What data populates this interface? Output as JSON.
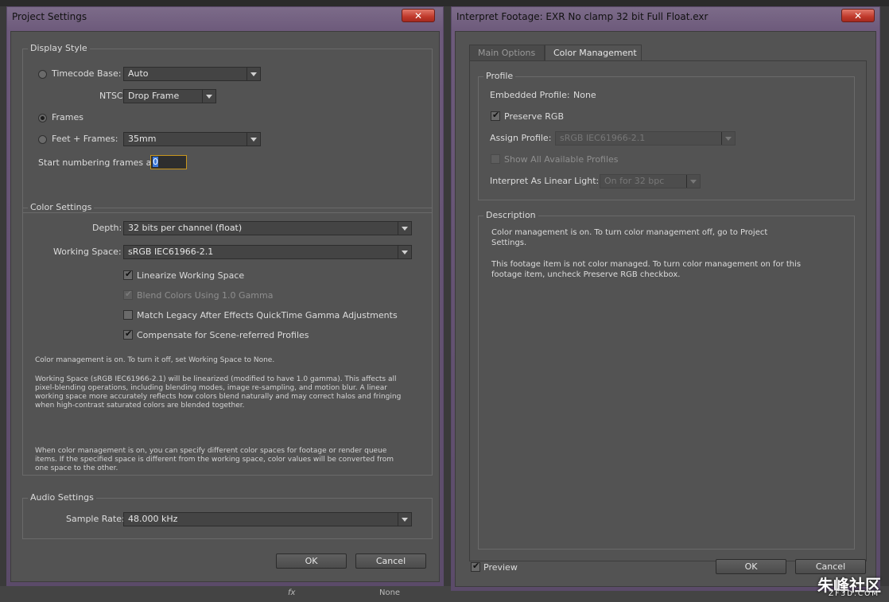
{
  "project_settings": {
    "title": "Project Settings",
    "display_style": {
      "title": "Display Style",
      "timecode_base_label": "Timecode Base:",
      "timecode_base_value": "Auto",
      "ntsc_label": "NTSC:",
      "ntsc_value": "Drop Frame",
      "frames_label": "Frames",
      "feet_frames_label": "Feet + Frames:",
      "feet_frames_value": "35mm",
      "start_numbering_label": "Start numbering frames at:",
      "start_numbering_value": "0",
      "selected_mode": "frames"
    },
    "color_settings": {
      "title": "Color Settings",
      "depth_label": "Depth:",
      "depth_value": "32 bits per channel (float)",
      "working_space_label": "Working Space:",
      "working_space_value": "sRGB IEC61966-2.1",
      "linearize_label": "Linearize Working Space",
      "linearize_checked": true,
      "blend_label": "Blend Colors Using 1.0 Gamma",
      "blend_checked": true,
      "blend_disabled": true,
      "match_legacy_label": "Match Legacy After Effects QuickTime Gamma Adjustments",
      "match_legacy_checked": false,
      "compensate_label": "Compensate for Scene-referred Profiles",
      "compensate_checked": true,
      "info_1": "Color management is on. To turn it off, set Working Space to None.",
      "info_2": "Working Space (sRGB IEC61966-2.1) will be linearized (modified to have 1.0 gamma). This affects all pixel-blending operations, including blending modes, image re-sampling, and motion blur. A linear working space more accurately reflects how colors blend naturally and may correct halos and fringing when high-contrast saturated colors are blended together.",
      "info_3": "When color management is on, you can specify different color spaces for footage or render queue items. If the specified space is different from the working space, color values will be converted from one space to the other."
    },
    "audio_settings": {
      "title": "Audio Settings",
      "sample_rate_label": "Sample Rate:",
      "sample_rate_value": "48.000 kHz"
    },
    "ok_label": "OK",
    "cancel_label": "Cancel"
  },
  "interpret_footage": {
    "title": "Interpret Footage: EXR No clamp 32 bit Full Float.exr",
    "tabs": [
      {
        "label": "Main Options",
        "active": false
      },
      {
        "label": "Color Management",
        "active": true
      }
    ],
    "profile": {
      "title": "Profile",
      "embedded_label": "Embedded Profile:",
      "embedded_value": "None",
      "preserve_rgb_label": "Preserve RGB",
      "preserve_rgb_checked": true,
      "assign_profile_label": "Assign Profile:",
      "assign_profile_value": "sRGB IEC61966-2.1",
      "show_all_label": "Show All Available Profiles",
      "interpret_linear_label": "Interpret As Linear Light:",
      "interpret_linear_value": "On for 32 bpc"
    },
    "description": {
      "title": "Description",
      "text_1": "Color management is on. To turn color management off, go to Project Settings.",
      "text_2": "This footage item is not color managed. To turn color management on for this footage item, uncheck Preserve RGB checkbox."
    },
    "preview_label": "Preview",
    "preview_checked": true,
    "ok_label": "OK",
    "cancel_label": "Cancel"
  },
  "background": {
    "fx_label": "fx",
    "none_label": "None"
  },
  "watermark": {
    "text": "朱峰社区",
    "sub": "ZF3D.COM"
  },
  "colors": {
    "panel_bg": "#535353",
    "title_gradient": "#6d5a7b",
    "close_red": "#c0392b",
    "focus_border": "#c8961e"
  }
}
